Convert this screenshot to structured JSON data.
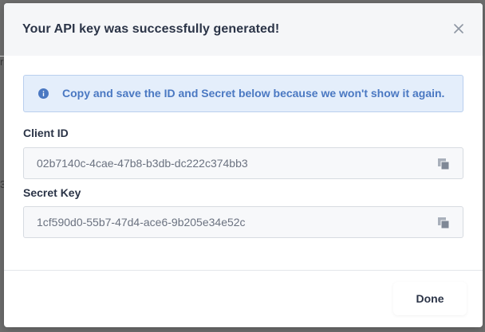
{
  "modal": {
    "title": "Your API key was successfully generated!",
    "close_icon": "close-icon"
  },
  "alert": {
    "icon": "info-icon",
    "message": "Copy and save the ID and Secret below because we won't show it again."
  },
  "fields": [
    {
      "label": "Client ID",
      "value": "02b7140c-4cae-47b8-b3db-dc222c374bb3",
      "icon": "copy-icon"
    },
    {
      "label": "Secret Key",
      "value": "1cf590d0-55b7-47d4-ace6-9b205e34e52c",
      "icon": "copy-icon"
    }
  ],
  "footer": {
    "done_label": "Done"
  },
  "backdrop": {
    "fragment_1": "r",
    "fragment_2": "3"
  },
  "colors": {
    "overlay": "#6e6e6e",
    "header_bg": "#f5f6f8",
    "alert_bg": "#e4eefb",
    "alert_border": "#b9cfee",
    "alert_text": "#4a78c2",
    "title_text": "#2b3447",
    "field_bg": "#f7f8fa"
  }
}
